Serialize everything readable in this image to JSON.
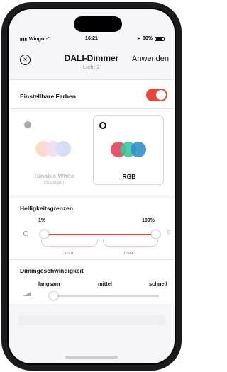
{
  "status_bar": {
    "carrier": "Wingo",
    "time": "16:21",
    "battery": "80%"
  },
  "header": {
    "title": "DALI-Dimmer",
    "subtitle": "Licht 2",
    "apply_label": "Anwenden"
  },
  "colors_section": {
    "title": "Einstellbare Farben",
    "toggle_on": true,
    "options": [
      {
        "label": "Tunable White",
        "sublabel": "(Standard)",
        "selected": false
      },
      {
        "label": "RGB",
        "sublabel": "",
        "selected": true
      }
    ]
  },
  "brightness_section": {
    "title": "Helligkeitsgrenzen",
    "min_value": "1%",
    "max_value": "100%",
    "min_label": "min",
    "max_label": "max",
    "accent_color": "#e5483a"
  },
  "speed_section": {
    "title": "Dimmgeschwindigkeit",
    "options": [
      "langsam",
      "mittel",
      "schnell"
    ],
    "selected": "langsam"
  }
}
